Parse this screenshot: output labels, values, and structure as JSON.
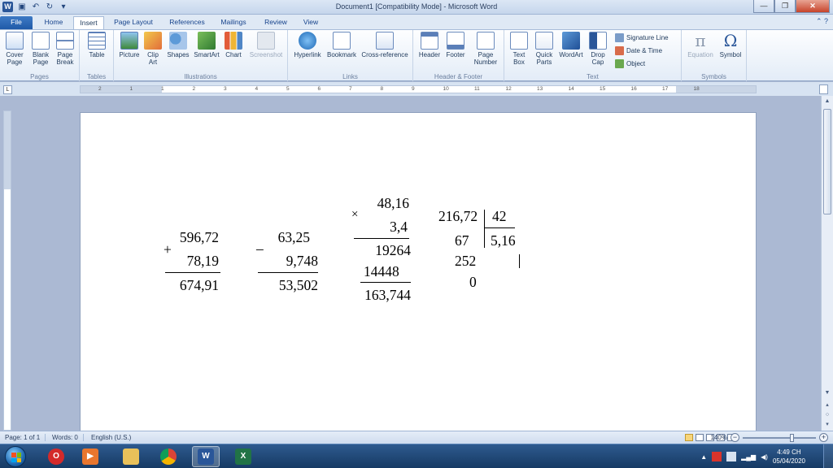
{
  "window": {
    "title": "Document1 [Compatibility Mode] - Microsoft Word",
    "minimize_glyph": "—",
    "maximize_glyph": "❐",
    "close_glyph": "✕"
  },
  "tabs": {
    "file": "File",
    "home": "Home",
    "insert": "Insert",
    "page_layout": "Page Layout",
    "references": "References",
    "mailings": "Mailings",
    "review": "Review",
    "view": "View"
  },
  "ribbon": {
    "groups": {
      "pages": "Pages",
      "tables": "Tables",
      "illustrations": "Illustrations",
      "links": "Links",
      "header_footer": "Header & Footer",
      "text": "Text",
      "symbols": "Symbols"
    },
    "buttons": {
      "cover_page": "Cover Page",
      "blank_page": "Blank Page",
      "page_break": "Page Break",
      "table": "Table",
      "picture": "Picture",
      "clip_art": "Clip Art",
      "shapes": "Shapes",
      "smartart": "SmartArt",
      "chart": "Chart",
      "screenshot": "Screenshot",
      "hyperlink": "Hyperlink",
      "bookmark": "Bookmark",
      "cross_reference": "Cross-reference",
      "header": "Header",
      "footer": "Footer",
      "page_number": "Page Number",
      "text_box": "Text Box",
      "quick_parts": "Quick Parts",
      "wordart": "WordArt",
      "drop_cap": "Drop Cap",
      "signature_line": "Signature Line",
      "date_time": "Date & Time",
      "object": "Object",
      "equation": "Equation",
      "symbol": "Symbol"
    }
  },
  "ruler": {
    "numbers": [
      "2",
      "1",
      "1",
      "2",
      "3",
      "4",
      "5",
      "6",
      "7",
      "8",
      "9",
      "10",
      "11",
      "12",
      "13",
      "14",
      "15",
      "16",
      "17",
      "18"
    ]
  },
  "document": {
    "addition": {
      "operator": "+",
      "top": "596,72",
      "bottom": "78,19",
      "result": "674,91"
    },
    "subtraction": {
      "operator": "–",
      "top": "63,25",
      "bottom": "9,748",
      "result": "53,502"
    },
    "multiplication": {
      "operator": "×",
      "top": "48,16",
      "bottom": "3,4",
      "partial1": "19264",
      "partial2": "14448",
      "result": "163,744"
    },
    "division": {
      "dividend": "216,72",
      "divisor": "42",
      "quotient": "5,16",
      "step1": "67",
      "step2": "252",
      "remainder": "0"
    }
  },
  "statusbar": {
    "page": "Page: 1 of 1",
    "words": "Words: 0",
    "language": "English (U.S.)",
    "zoom": "140%"
  },
  "taskbar": {
    "time": "4:49 CH",
    "date": "05/04/2020"
  }
}
